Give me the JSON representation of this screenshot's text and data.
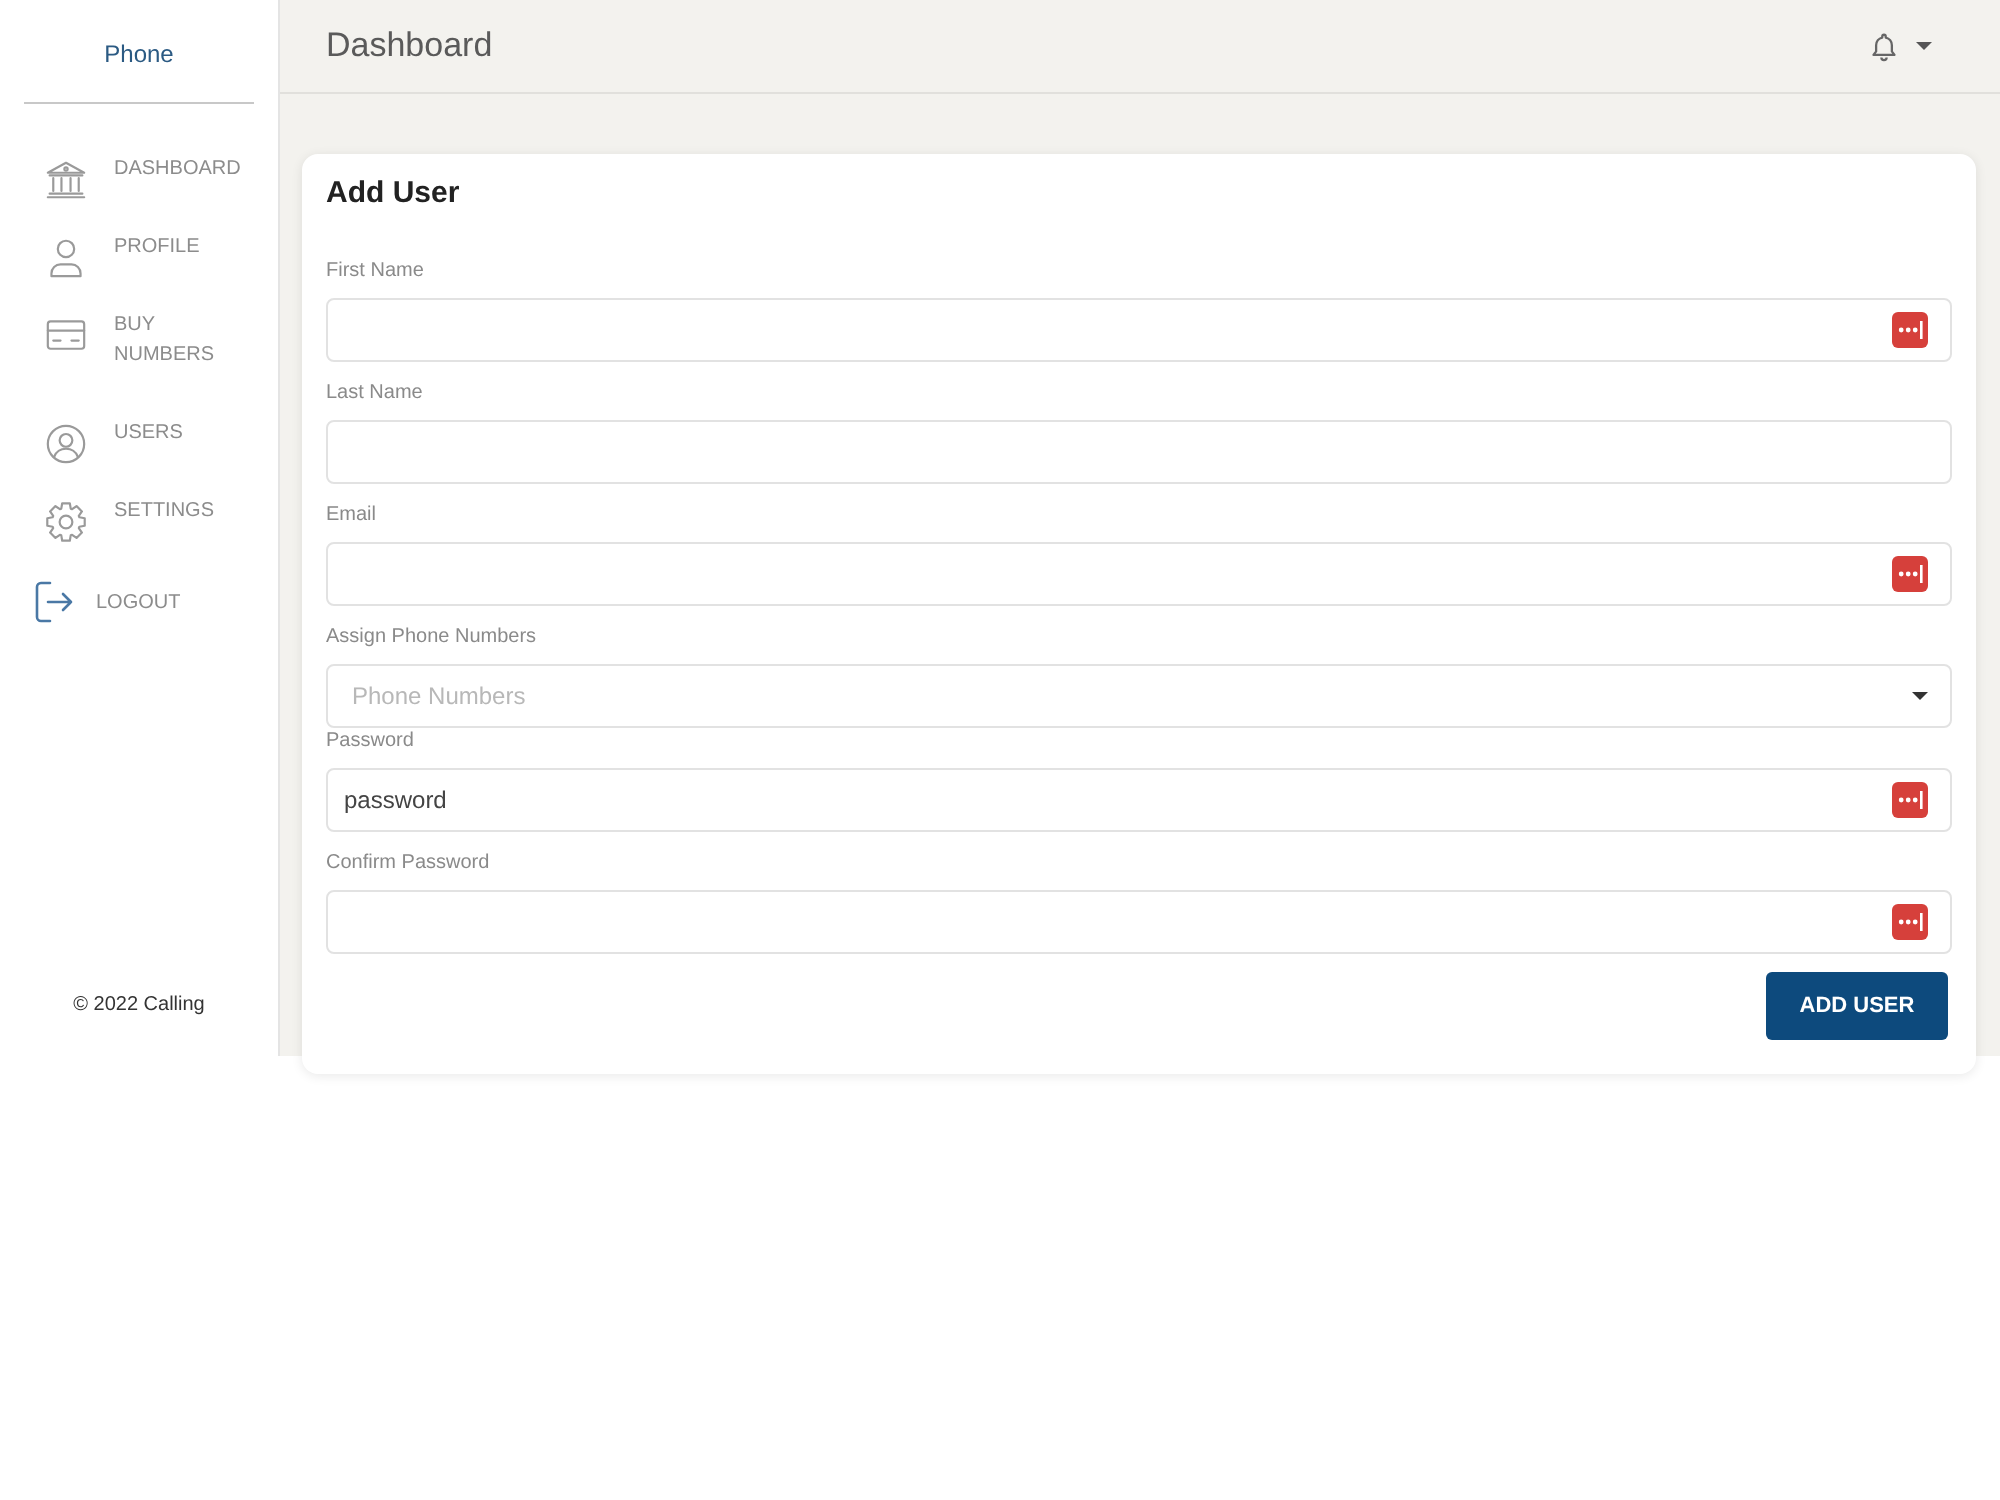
{
  "sidebar": {
    "brand": "Phone",
    "items": [
      {
        "kind": "nav",
        "label": "DASHBOARD"
      },
      {
        "kind": "nav",
        "label": "PROFILE"
      },
      {
        "kind": "nav",
        "label": "BUY NUMBERS"
      },
      {
        "kind": "nav",
        "label": "USERS"
      },
      {
        "kind": "nav",
        "label": "SETTINGS"
      },
      {
        "kind": "action",
        "label": "LOGOUT"
      }
    ],
    "footer": "© 2022 Calling"
  },
  "header": {
    "title": "Dashboard"
  },
  "form": {
    "title": "Add User",
    "fields": [
      {
        "kind": "input",
        "label": "First Name",
        "autofill_icon": true
      },
      {
        "kind": "input",
        "label": "Last Name",
        "autofill_icon": false
      },
      {
        "kind": "input",
        "label": "Email",
        "autofill_icon": true
      },
      {
        "kind": "select",
        "label": "Assign Phone Numbers",
        "placeholder": "Phone Numbers"
      },
      {
        "kind": "input",
        "label": "Password",
        "value": "password",
        "autofill_icon": true
      },
      {
        "kind": "input",
        "label": "Confirm Password",
        "autofill_icon": true
      }
    ],
    "submit": "ADD USER"
  }
}
